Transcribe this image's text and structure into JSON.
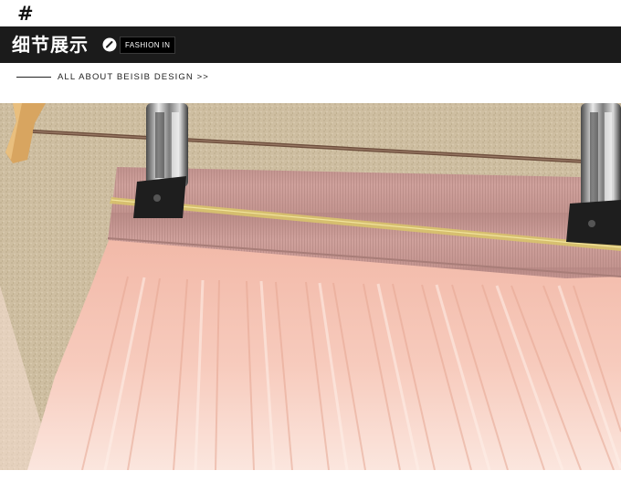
{
  "header": {
    "hash_symbol": "#",
    "title": "细节展示",
    "title_icon": "circle-slash-icon",
    "tag": "FASHION IN",
    "subtitle": "ALL ABOUT BEISIB DESIGN >>"
  },
  "photo": {
    "icons": [
      "hanger-clip-icon",
      "hanger-clip-icon",
      "wooden-hanger-icon"
    ]
  },
  "colors": {
    "banner_bg": "#1b1b1b",
    "waistband": "#c99a96",
    "gold_stripe": "#d6c068",
    "skirt_pink": "#f6c7b9",
    "background_wall": "#c8b89a"
  }
}
